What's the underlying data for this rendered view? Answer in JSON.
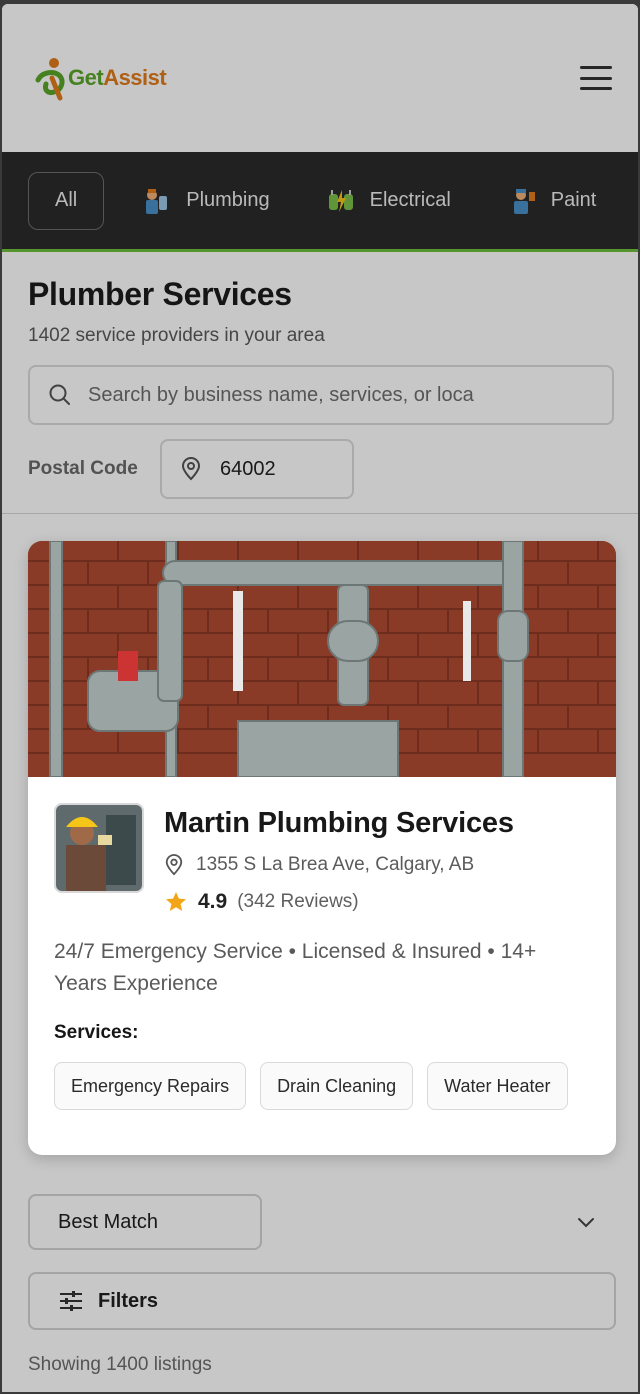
{
  "header": {
    "logo_text_green": "Get",
    "logo_text_orange": "Assist",
    "menu_icon": "hamburger-icon"
  },
  "categories": [
    {
      "label": "All",
      "icon": ""
    },
    {
      "label": "Plumbing",
      "icon": "plumber-icon"
    },
    {
      "label": "Electrical",
      "icon": "electrician-icon"
    },
    {
      "label": "Paint",
      "icon": "painter-icon"
    }
  ],
  "page": {
    "title": "Plumber Services",
    "subtitle": "1402 service providers in your area"
  },
  "search": {
    "placeholder": "Search by business name, services, or loca"
  },
  "postal": {
    "label": "Postal Code",
    "value": "64002"
  },
  "card": {
    "name": "Martin Plumbing Services",
    "address": "1355 S La Brea Ave, Calgary, AB",
    "rating": "4.9",
    "reviews": "(342 Reviews)",
    "description": "24/7 Emergency Service • Licensed & Insured • 14+ Years Experience",
    "services_title": "Services:",
    "services": [
      "Emergency Repairs",
      "Drain Cleaning",
      "Water Heater"
    ]
  },
  "controls": {
    "sort_label": "Best Match",
    "filters_label": "Filters",
    "showing": "Showing 1400 listings"
  },
  "colors": {
    "brand_green": "#5aa62a",
    "brand_orange": "#e07b1a",
    "catbar_bg": "#2b2b2b",
    "accent_line": "#6fbf3a",
    "star": "#f2a516"
  }
}
